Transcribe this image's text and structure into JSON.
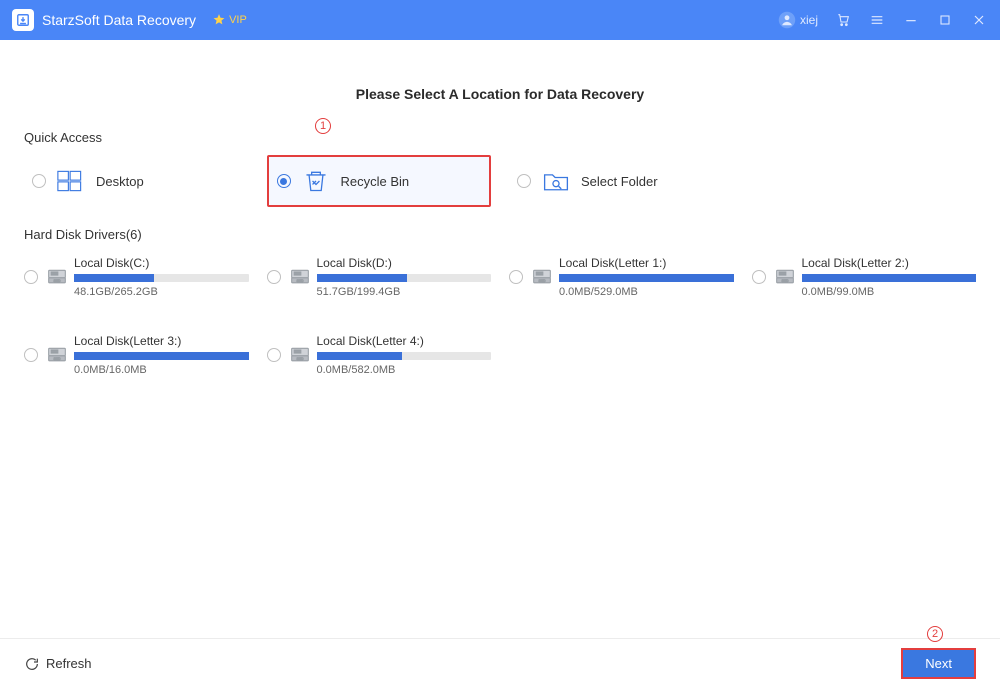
{
  "titlebar": {
    "app_name": "StarzSoft Data Recovery",
    "vip_label": "VIP",
    "username": "xiej"
  },
  "page": {
    "heading": "Please Select A Location for Data Recovery",
    "quick_access_label": "Quick Access",
    "drives_label": "Hard Disk Drivers(6)"
  },
  "quick_access": [
    {
      "label": "Desktop",
      "selected": false,
      "icon": "desktop-icon"
    },
    {
      "label": "Recycle Bin",
      "selected": true,
      "icon": "trash-icon"
    },
    {
      "label": "Select Folder",
      "selected": false,
      "icon": "folder-search-icon"
    }
  ],
  "drives": [
    {
      "name": "Local Disk(C:)",
      "usage": "48.1GB/265.2GB",
      "fill_percent": 46
    },
    {
      "name": "Local Disk(D:)",
      "usage": "51.7GB/199.4GB",
      "fill_percent": 52
    },
    {
      "name": "Local Disk(Letter 1:)",
      "usage": "0.0MB/529.0MB",
      "fill_percent": 100
    },
    {
      "name": "Local Disk(Letter 2:)",
      "usage": "0.0MB/99.0MB",
      "fill_percent": 100
    },
    {
      "name": "Local Disk(Letter 3:)",
      "usage": "0.0MB/16.0MB",
      "fill_percent": 100
    },
    {
      "name": "Local Disk(Letter 4:)",
      "usage": "0.0MB/582.0MB",
      "fill_percent": 49
    }
  ],
  "footer": {
    "refresh_label": "Refresh",
    "next_label": "Next"
  },
  "annotations": {
    "step1": "1",
    "step2": "2"
  }
}
